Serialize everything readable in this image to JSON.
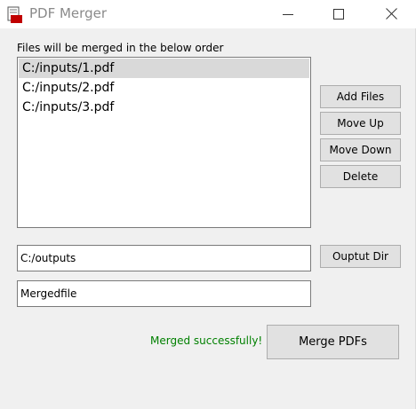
{
  "window": {
    "title": "PDF Merger",
    "icon": "pdf-document-icon",
    "controls": {
      "minimize_icon": "minimize-icon",
      "maximize_icon": "maximize-icon",
      "close_icon": "close-icon"
    }
  },
  "files": {
    "label": "Files will be merged in the below order",
    "items": [
      {
        "path": "C:/inputs/1.pdf",
        "selected": true
      },
      {
        "path": "C:/inputs/2.pdf",
        "selected": false
      },
      {
        "path": "C:/inputs/3.pdf",
        "selected": false
      }
    ]
  },
  "buttons": {
    "add_files": "Add Files",
    "move_up": "Move Up",
    "move_down": "Move Down",
    "delete": "Delete",
    "output_dir": "Ouptut Dir",
    "merge": "Merge PDFs"
  },
  "output": {
    "directory": "C:/outputs",
    "filename": "Mergedfile"
  },
  "status": {
    "message": "Merged successfully!",
    "color": "#008000"
  },
  "colors": {
    "window_bg": "#f0f0f0",
    "selection_bg": "#d9d9d9",
    "button_bg": "#e1e1e1",
    "icon_pdf": "#c00000"
  }
}
